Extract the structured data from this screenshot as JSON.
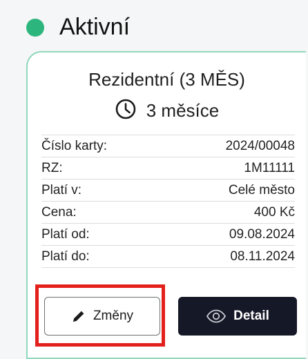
{
  "status": {
    "label": "Aktivní",
    "color": "#2cb67d"
  },
  "card": {
    "title": "Rezidentní (3 MĚS)",
    "duration_icon": "clock-icon",
    "duration": "3 měsíce",
    "rows": [
      {
        "label": "Číslo karty:",
        "value": "2024/00048"
      },
      {
        "label": "RZ:",
        "value": "1M11111"
      },
      {
        "label": "Platí v:",
        "value": "Celé město"
      },
      {
        "label": "Cena:",
        "value": "400 Kč"
      },
      {
        "label": "Platí od:",
        "value": "09.08.2024"
      },
      {
        "label": "Platí do:",
        "value": "08.11.2024"
      }
    ],
    "buttons": {
      "edit": {
        "label": "Změny",
        "icon": "pencil-icon"
      },
      "detail": {
        "label": "Detail",
        "icon": "eye-icon"
      }
    }
  },
  "colors": {
    "card_border": "#8fd8bb",
    "detail_button_bg": "#151827",
    "highlight": "#e3201b"
  }
}
